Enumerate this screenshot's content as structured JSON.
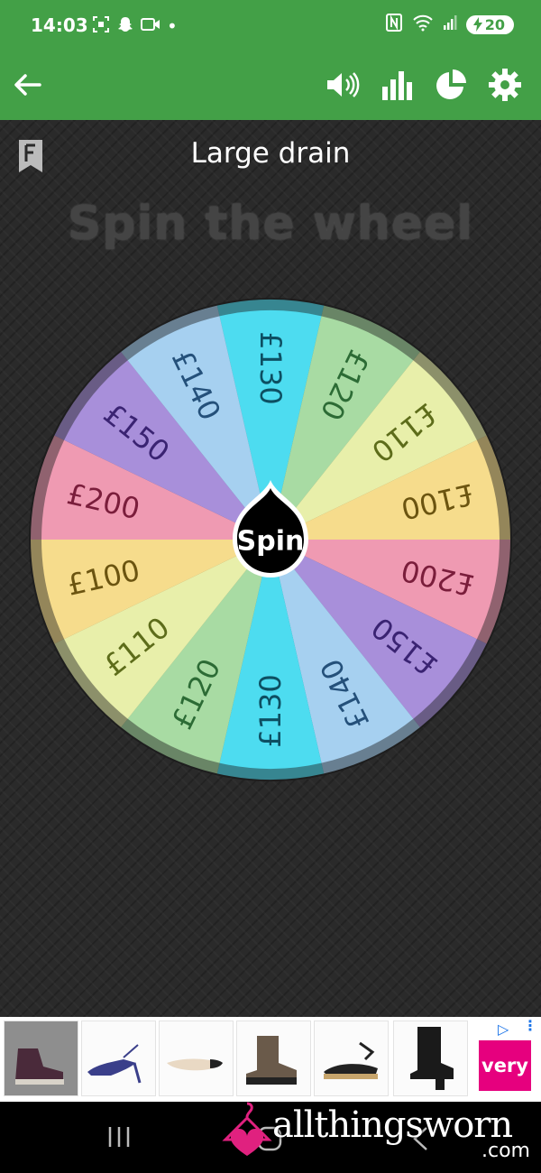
{
  "status_bar": {
    "time": "14:03",
    "dot": "•",
    "battery_level": "20",
    "icons": [
      "screenshot-icon",
      "snapchat-icon",
      "video-camera-icon",
      "nfc-icon",
      "wifi-icon",
      "signal-icon",
      "battery-charging-icon"
    ]
  },
  "app_bar": {
    "back_icon": "arrow-left-icon",
    "actions": [
      "volume-icon",
      "bar-chart-icon",
      "pie-chart-icon",
      "gear-icon"
    ]
  },
  "wheel": {
    "name": "Large drain",
    "heading": "Spin the wheel",
    "spin_label": "Spin",
    "segments": [
      {
        "label": "£130",
        "color": "#4ddcf0",
        "text_color": "#0d4f62"
      },
      {
        "label": "£120",
        "color": "#a8dba3",
        "text_color": "#2c6b35"
      },
      {
        "label": "£110",
        "color": "#e8efaa",
        "text_color": "#5d6c1a"
      },
      {
        "label": "£100",
        "color": "#f6dc8c",
        "text_color": "#6b5410"
      },
      {
        "label": "£200",
        "color": "#ef9ab2",
        "text_color": "#7a1d3b"
      },
      {
        "label": "£150",
        "color": "#a88fda",
        "text_color": "#3a2372"
      },
      {
        "label": "£140",
        "color": "#a6d0f0",
        "text_color": "#24507a"
      },
      {
        "label": "£130",
        "color": "#4ddcf0",
        "text_color": "#0d4f62"
      },
      {
        "label": "£120",
        "color": "#a8dba3",
        "text_color": "#2c6b35"
      },
      {
        "label": "£110",
        "color": "#e8efaa",
        "text_color": "#5d6c1a"
      },
      {
        "label": "£100",
        "color": "#f6dc8c",
        "text_color": "#6b5410"
      },
      {
        "label": "£200",
        "color": "#ef9ab2",
        "text_color": "#7a1d3b"
      },
      {
        "label": "£150",
        "color": "#a88fda",
        "text_color": "#3a2372"
      },
      {
        "label": "£140",
        "color": "#a6d0f0",
        "text_color": "#24507a"
      }
    ]
  },
  "ad": {
    "products": [
      "hiking-boot",
      "slingback-heel",
      "ballet-flat",
      "chelsea-boot",
      "espadrille",
      "heeled-ankle-boot"
    ],
    "brand": "very"
  },
  "watermark": {
    "text": "allthingsworn",
    "suffix": ".com"
  },
  "nav_bar": {
    "buttons": [
      "recent-apps-icon",
      "home-icon",
      "back-icon"
    ]
  },
  "colors": {
    "app_green": "#43a047",
    "background": "#2a2a2a",
    "heading_gray": "#444444",
    "brand_pink": "#e6007e"
  }
}
